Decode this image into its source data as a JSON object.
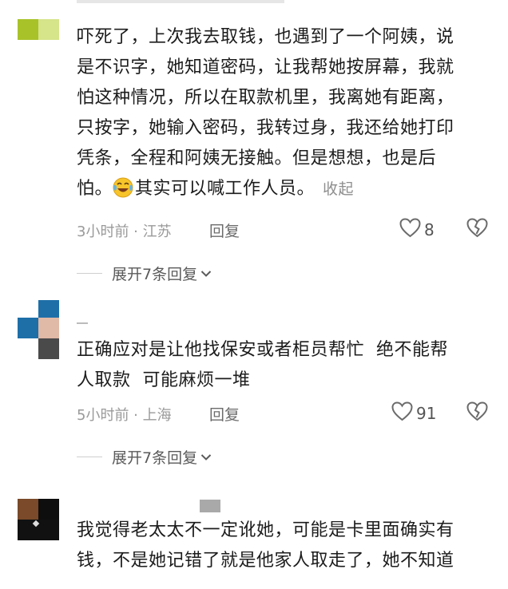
{
  "comments": [
    {
      "text_lines": [
        "吓死了，上次我去取钱，也遇到了一个阿姨，说",
        "是不识字，她知道密码，让我帮她按屏幕，我就",
        "怕这种情况，所以在取款机里，我离她有距离，",
        "只按字，她输入密码，我转过身，我还给她打印",
        "凭条，全程和阿姨无接触。但是想想，也是后"
      ],
      "last_line_prefix": "怕。",
      "emoji": "laughing-tears-emoji",
      "last_line_suffix": "其实可以喊工作人员。",
      "collapse_label": "收起",
      "meta": "3小时前 · 江苏",
      "reply_label": "回复",
      "likes": "8",
      "expand_label": "展开7条回复"
    },
    {
      "text_lines": [
        "正确应对是让他找保安或者柜员帮忙  绝不能帮",
        "人取款  可能麻烦一堆"
      ],
      "meta": "5小时前 · 上海",
      "reply_label": "回复",
      "likes": "91",
      "expand_label": "展开7条回复"
    },
    {
      "text_lines": [
        "我觉得老太太不一定讹她，可能是卡里面确实有",
        "钱，不是她记错了就是他家人取走了，她不知道"
      ]
    }
  ],
  "colors": {
    "text": "#1c1c1c",
    "meta": "#9a9a9a",
    "icon": "#6b6b6b"
  }
}
